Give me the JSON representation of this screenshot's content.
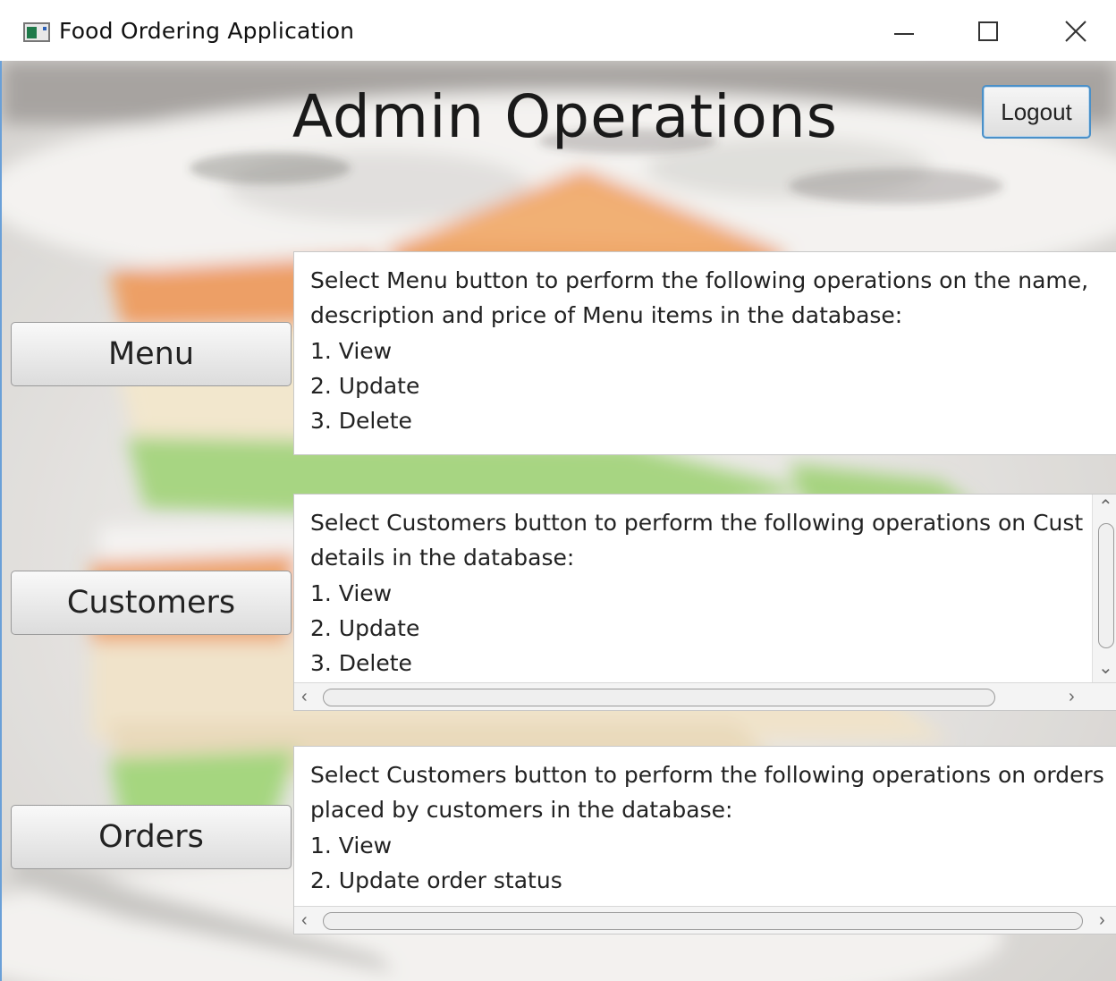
{
  "window": {
    "title": "Food Ordering Application"
  },
  "header": {
    "title": "Admin Operations",
    "logout_label": "Logout"
  },
  "sections": [
    {
      "button_label": "Menu",
      "lines": [
        "Select Menu button to perform the following operations on the name,",
        "description and price of Menu items in the database:",
        "1. View",
        "2. Update",
        "3. Delete"
      ]
    },
    {
      "button_label": "Customers",
      "lines": [
        "Select Customers button to perform the following operations on Cust",
        "details in the database:",
        "1. View",
        "2. Update",
        "3. Delete"
      ]
    },
    {
      "button_label": "Orders",
      "lines": [
        "Select Customers button to perform the following operations on orders",
        "placed by customers in the database:",
        "1. View",
        "2. Update order status"
      ]
    }
  ],
  "icons": {
    "app": "app-window-icon",
    "minimize": "minimize-icon",
    "maximize": "maximize-icon",
    "close": "close-icon",
    "scroll_up": "chevron-up-icon",
    "scroll_down": "chevron-down-icon",
    "scroll_left": "chevron-left-icon",
    "scroll_right": "chevron-right-icon"
  },
  "colors": {
    "accent_border": "#4a90c8",
    "panel_background": "#ffffff"
  }
}
